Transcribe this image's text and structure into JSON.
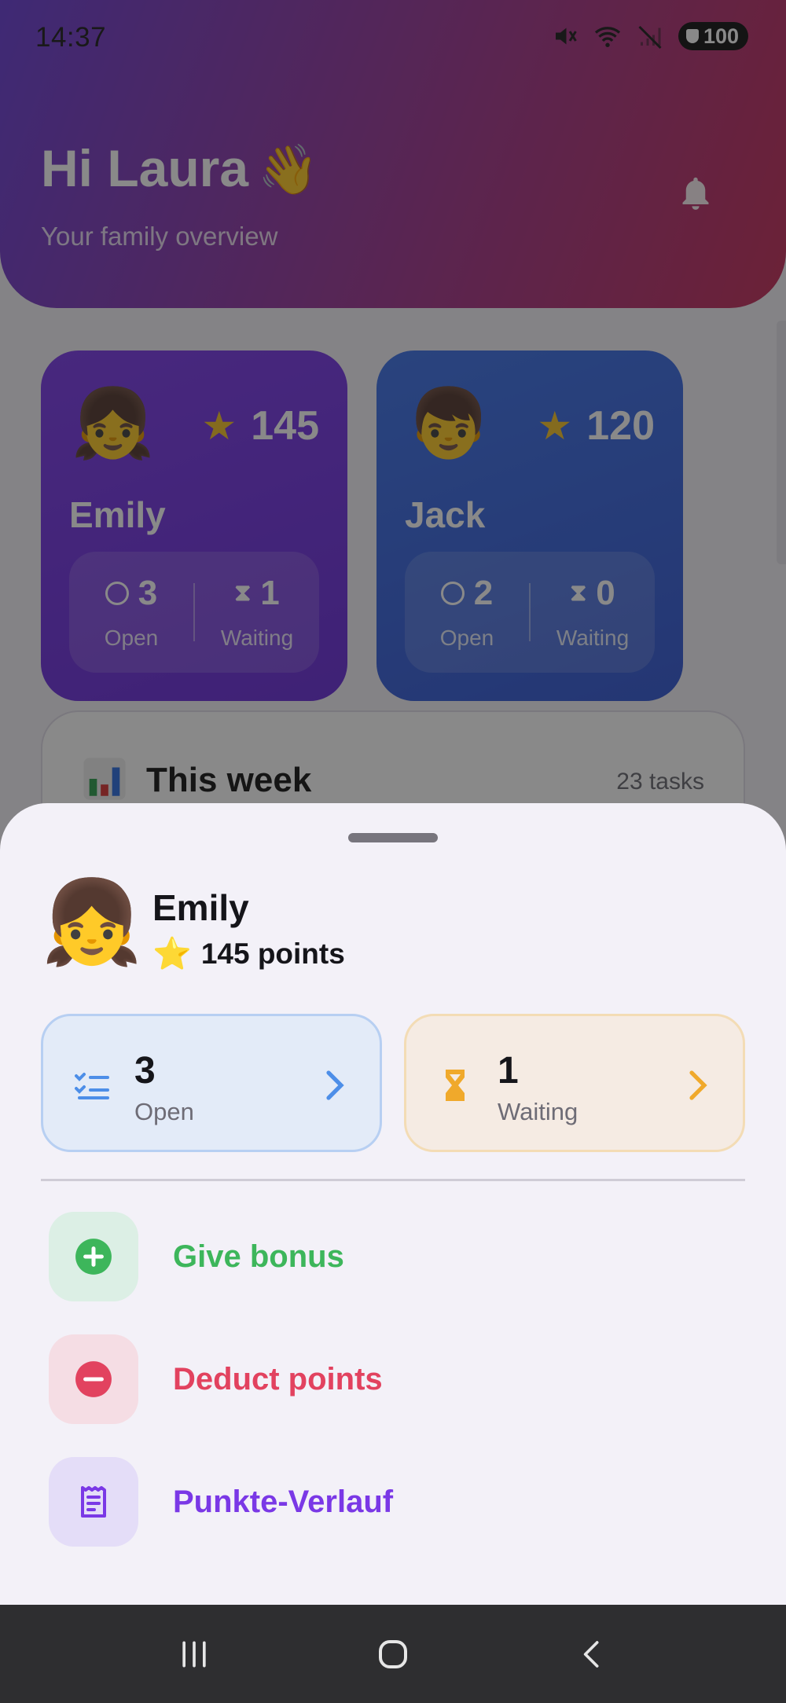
{
  "status_bar": {
    "time": "14:37",
    "battery": "100"
  },
  "header": {
    "greeting": "Hi Laura",
    "greeting_emoji": "👋",
    "subtitle": "Your family overview"
  },
  "kids": [
    {
      "avatar": "👧",
      "name": "Emily",
      "points": "145",
      "open_count": "3",
      "open_label": "Open",
      "waiting_count": "1",
      "waiting_label": "Waiting",
      "color": "#7c3ce8"
    },
    {
      "avatar": "👦",
      "name": "Jack",
      "points": "120",
      "open_count": "2",
      "open_label": "Open",
      "waiting_count": "0",
      "waiting_label": "Waiting",
      "color": "#3f73e8"
    }
  ],
  "week": {
    "title": "This week",
    "count": "23 tasks"
  },
  "sheet": {
    "avatar": "👧",
    "name": "Emily",
    "star": "⭐",
    "points_text": "145 points",
    "open": {
      "count": "3",
      "label": "Open",
      "color": "#4d8ee8"
    },
    "waiting": {
      "count": "1",
      "label": "Waiting",
      "color": "#f0a92b"
    },
    "actions": [
      {
        "label": "Give bonus",
        "icon": "plus-circle-icon",
        "color": "#3db65b"
      },
      {
        "label": "Deduct points",
        "icon": "minus-circle-icon",
        "color": "#e2425f"
      },
      {
        "label": "Punkte-Verlauf",
        "icon": "receipt-icon",
        "color": "#7a38e6"
      }
    ]
  },
  "icons": {
    "star": "★",
    "hourglass": "⧗"
  }
}
